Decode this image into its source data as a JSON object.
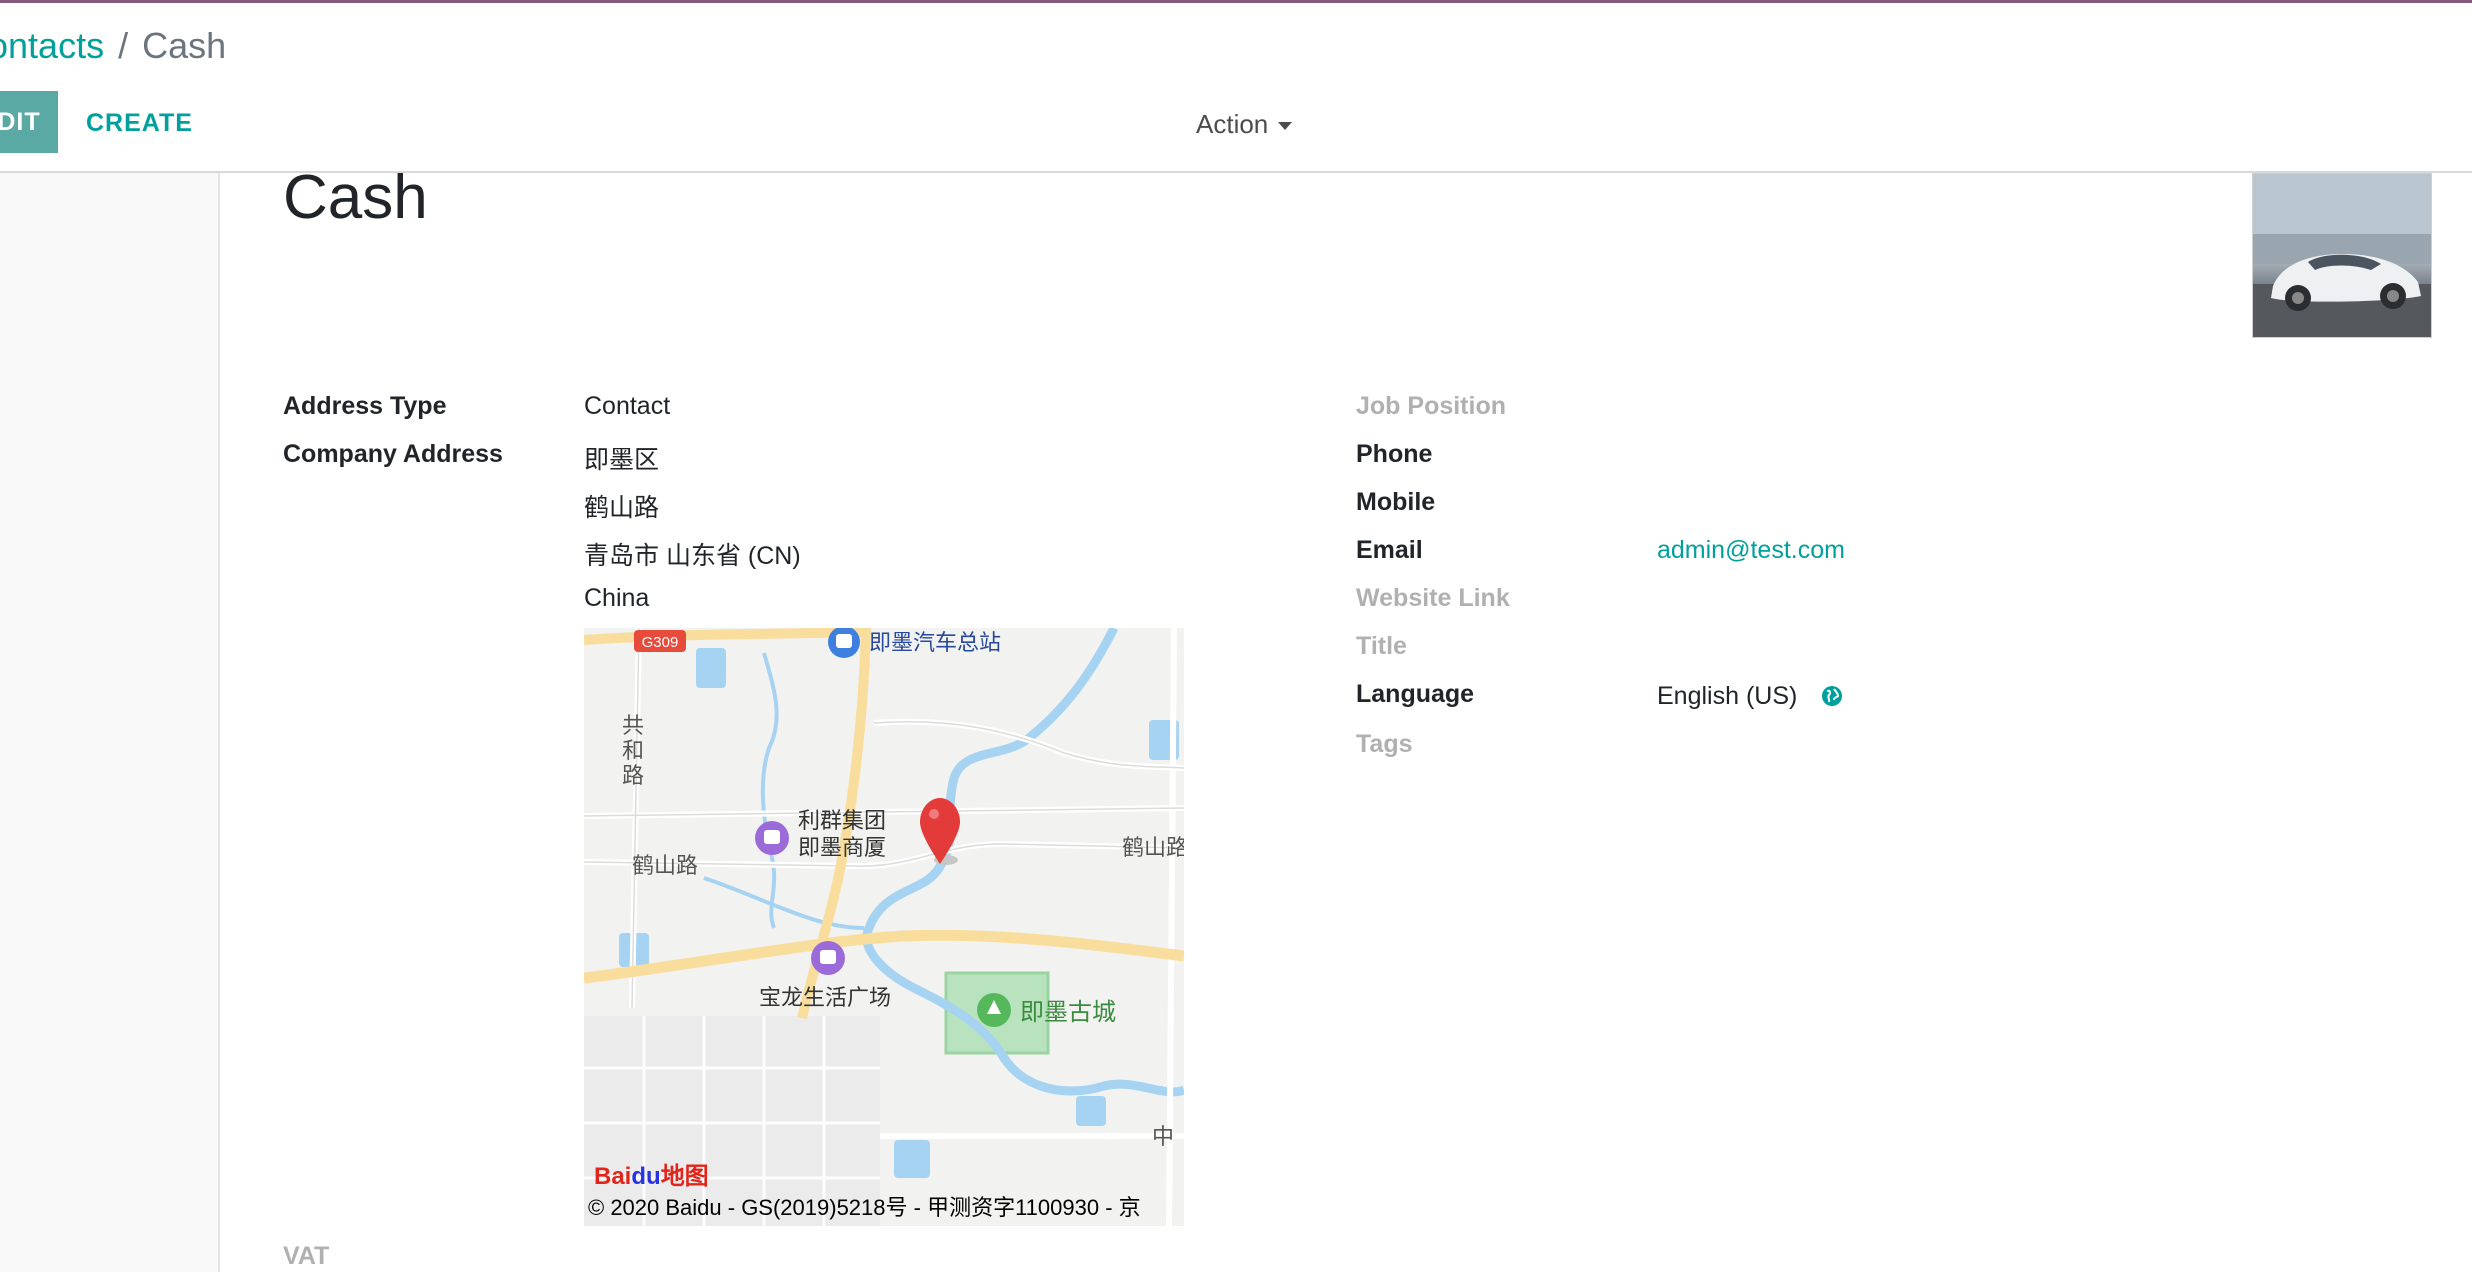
{
  "breadcrumb": {
    "parent": "ontacts",
    "separator": "/",
    "current": "Cash"
  },
  "toolbar": {
    "edit_label": "DIT",
    "create_label": "CREATE",
    "action_label": "Action"
  },
  "record": {
    "name": "Cash"
  },
  "left_fields": {
    "address_type": {
      "label": "Address Type",
      "value": "Contact"
    },
    "company_address": {
      "label": "Company Address",
      "lines": [
        "即墨区",
        "鹤山路",
        "青岛市  山东省 (CN)",
        "China"
      ]
    }
  },
  "right_fields": {
    "job_position": {
      "label": "Job Position"
    },
    "phone": {
      "label": "Phone"
    },
    "mobile": {
      "label": "Mobile"
    },
    "email": {
      "label": "Email",
      "value": "admin@test.com"
    },
    "website": {
      "label": "Website Link"
    },
    "title": {
      "label": "Title"
    },
    "language": {
      "label": "Language",
      "value": "English (US)"
    },
    "tags": {
      "label": "Tags"
    }
  },
  "vat": {
    "label": "VAT"
  },
  "map": {
    "labels": {
      "g309": "G309",
      "bus_station": "即墨汽车总站",
      "gonghe_road": [
        "共",
        "和",
        "路"
      ],
      "liqun_1": "利群集团",
      "liqun_2": "即墨商厦",
      "heshan_road_left": "鹤山路",
      "heshan_road_right": "鹤山路",
      "baolong": "宝龙生活广场",
      "old_town": "即墨古城",
      "zhong": "中"
    },
    "logo_bai": "Bai",
    "logo_du": "du",
    "logo_ditu": "地图",
    "copyright": "© 2020 Baidu - GS(2019)5218号 - 甲测资字1100930 - 京"
  },
  "colors": {
    "accent": "#00a09d",
    "brand": "#875a7b",
    "muted_label": "#b0b0b0"
  },
  "icons": {
    "language": "globe-icon",
    "pin": "map-pin-icon"
  }
}
